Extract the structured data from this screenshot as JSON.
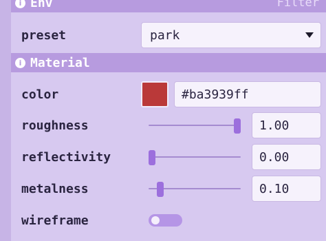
{
  "env": {
    "title": "Env",
    "filter_label": "Filter",
    "preset_label": "preset",
    "preset_value": "park"
  },
  "material": {
    "title": "Material",
    "color_label": "color",
    "color_value": "#ba3939ff",
    "color_hex": "#ba3939",
    "roughness_label": "roughness",
    "roughness_value": "1.00",
    "roughness_level": 1.0,
    "reflectivity_label": "reflectivity",
    "reflectivity_value": "0.00",
    "reflectivity_level": 0.0,
    "metalness_label": "metalness",
    "metalness_value": "0.10",
    "metalness_level": 0.1,
    "wireframe_label": "wireframe",
    "wireframe_on": false
  },
  "colors": {
    "accent": "#9c6fdd",
    "header": "#b79bdf",
    "panel": "#d7c9f0"
  },
  "icons": {
    "section_header": "info-icon",
    "select": "chevron-down-icon"
  }
}
